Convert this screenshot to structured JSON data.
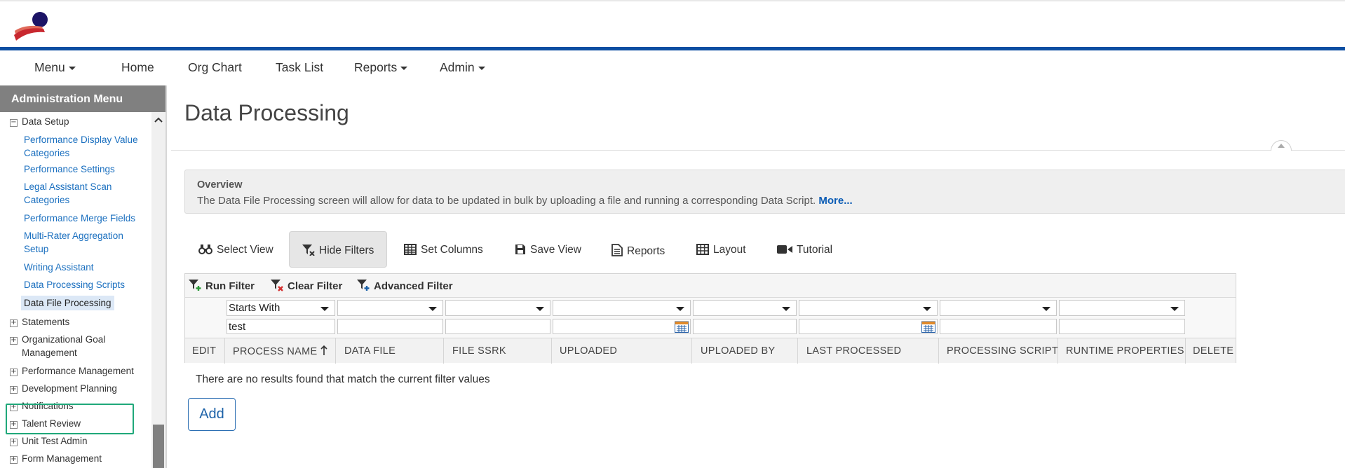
{
  "nav": {
    "menu_label": "Menu",
    "home_label": "Home",
    "org_chart_label": "Org Chart",
    "task_list_label": "Task List",
    "reports_label": "Reports",
    "admin_label": "Admin"
  },
  "sidebar": {
    "title": "Administration Menu",
    "data_setup": "Data Setup",
    "links": [
      "Performance Display Value Categories",
      "Performance Settings",
      "Legal Assistant Scan Categories",
      "Performance Merge Fields",
      "Multi-Rater Aggregation Setup",
      "Writing Assistant",
      "Data Processing Scripts",
      "Data File Processing"
    ],
    "sections": [
      "Statements",
      "Organizational Goal Management",
      "Performance Management",
      "Development Planning",
      "Notifications",
      "Talent Review",
      "Unit Test Admin",
      "Form Management"
    ]
  },
  "page": {
    "title": "Data Processing"
  },
  "overview": {
    "title": "Overview",
    "text": "The Data File Processing screen will allow for data to be updated in bulk by uploading a file and running a corresponding Data Script.",
    "more": "More..."
  },
  "toolbar": {
    "select_view": "Select View",
    "hide_filters": "Hide Filters",
    "set_columns": "Set Columns",
    "save_view": "Save View",
    "reports": "Reports",
    "layout": "Layout",
    "tutorial": "Tutorial"
  },
  "filters": {
    "run": "Run Filter",
    "clear": "Clear Filter",
    "advanced": "Advanced Filter",
    "process_name_operator": "Starts With",
    "process_name_value": "test"
  },
  "columns": [
    "EDIT",
    "PROCESS NAME",
    "DATA FILE",
    "FILE SSRK",
    "UPLOADED",
    "UPLOADED BY",
    "LAST PROCESSED",
    "PROCESSING SCRIPT",
    "RUNTIME PROPERTIES",
    "DELETE"
  ],
  "results": {
    "empty_message": "There are no results found that match the current filter values"
  },
  "actions": {
    "add": "Add"
  },
  "colors": {
    "brand_blue": "#0b4ea2",
    "logo_navy": "#1c1466",
    "logo_red": "#c8282f",
    "link_blue": "#1a6fbf",
    "selection_outline": "#1fa87a",
    "sidebar_header": "#808080"
  },
  "icons": {
    "select_view": "binoculars-icon",
    "hide_filters": "filter-icon",
    "set_columns": "table-icon",
    "save_view": "floppy-icon",
    "reports": "document-icon",
    "layout": "grid-icon",
    "tutorial": "video-camera-icon",
    "calendar": "calendar-icon",
    "sort": "sort-ascending-icon"
  }
}
